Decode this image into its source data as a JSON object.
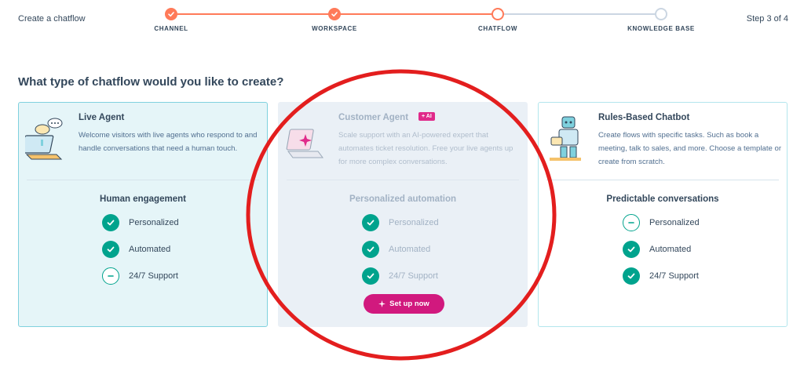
{
  "header": {
    "title": "Create a chatflow",
    "step_indicator": "Step 3 of 4"
  },
  "stepper": {
    "steps": [
      {
        "label": "CHANNEL",
        "state": "done"
      },
      {
        "label": "WORKSPACE",
        "state": "done"
      },
      {
        "label": "CHATFLOW",
        "state": "current"
      },
      {
        "label": "KNOWLEDGE BASE",
        "state": "todo"
      }
    ]
  },
  "question": "What type of chatflow would you like to create?",
  "cards": [
    {
      "title": "Live Agent",
      "description": "Welcome visitors with live agents who respond to and handle conversations that need a human touch.",
      "feature_heading": "Human engagement",
      "features": [
        {
          "label": "Personalized",
          "icon": "check"
        },
        {
          "label": "Automated",
          "icon": "check"
        },
        {
          "label": "24/7 Support",
          "icon": "minus"
        }
      ]
    },
    {
      "title": "Customer Agent",
      "badge": "+ AI",
      "description": "Scale support with an AI-powered expert that automates ticket resolution. Free your live agents up for more complex conversations.",
      "feature_heading": "Personalized automation",
      "features": [
        {
          "label": "Personalized",
          "icon": "check"
        },
        {
          "label": "Automated",
          "icon": "check"
        },
        {
          "label": "24/7 Support",
          "icon": "check"
        }
      ],
      "button_label": "Set up now"
    },
    {
      "title": "Rules-Based Chatbot",
      "description": "Create flows with specific tasks. Such as book a meeting, talk to sales, and more. Choose a template or create from scratch.",
      "feature_heading": "Predictable conversations",
      "features": [
        {
          "label": "Personalized",
          "icon": "minus"
        },
        {
          "label": "Automated",
          "icon": "check"
        },
        {
          "label": "24/7 Support",
          "icon": "check"
        }
      ]
    }
  ],
  "colors": {
    "accent_orange": "#ff7a59",
    "check_teal": "#00a38d",
    "ai_pink": "#d1197e",
    "annotation_red": "#e31e1e"
  }
}
